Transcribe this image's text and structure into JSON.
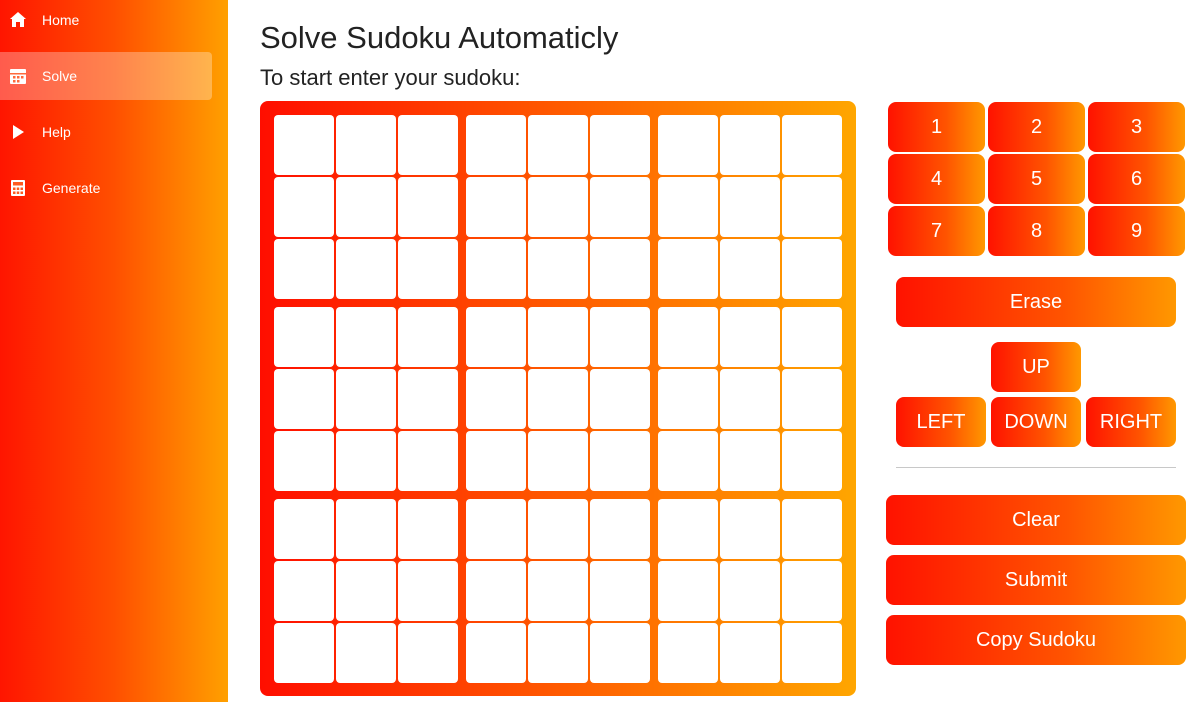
{
  "sidebar": {
    "items": [
      {
        "label": "Home",
        "icon": "home-icon",
        "active": false
      },
      {
        "label": "Solve",
        "icon": "calendar-icon",
        "active": true
      },
      {
        "label": "Help",
        "icon": "play-icon",
        "active": false
      },
      {
        "label": "Generate",
        "icon": "calculator-icon",
        "active": false
      }
    ]
  },
  "main": {
    "title": "Solve Sudoku Automaticly",
    "subtitle": "To start enter your sudoku:"
  },
  "board": {
    "rows": 9,
    "cols": 9,
    "cells": [
      [
        "",
        "",
        "",
        "",
        "",
        "",
        "",
        "",
        ""
      ],
      [
        "",
        "",
        "",
        "",
        "",
        "",
        "",
        "",
        ""
      ],
      [
        "",
        "",
        "",
        "",
        "",
        "",
        "",
        "",
        ""
      ],
      [
        "",
        "",
        "",
        "",
        "",
        "",
        "",
        "",
        ""
      ],
      [
        "",
        "",
        "",
        "",
        "",
        "",
        "",
        "",
        ""
      ],
      [
        "",
        "",
        "",
        "",
        "",
        "",
        "",
        "",
        ""
      ],
      [
        "",
        "",
        "",
        "",
        "",
        "",
        "",
        "",
        ""
      ],
      [
        "",
        "",
        "",
        "",
        "",
        "",
        "",
        "",
        ""
      ],
      [
        "",
        "",
        "",
        "",
        "",
        "",
        "",
        "",
        ""
      ]
    ]
  },
  "numpad": [
    "1",
    "2",
    "3",
    "4",
    "5",
    "6",
    "7",
    "8",
    "9"
  ],
  "controls": {
    "erase": "Erase",
    "up": "UP",
    "left": "LEFT",
    "down": "DOWN",
    "right": "RIGHT",
    "clear": "Clear",
    "submit": "Submit",
    "copy": "Copy Sudoku"
  },
  "colors": {
    "gradient_start": "#ff1200",
    "gradient_mid": "#ff5400",
    "gradient_end": "#ffa000"
  }
}
